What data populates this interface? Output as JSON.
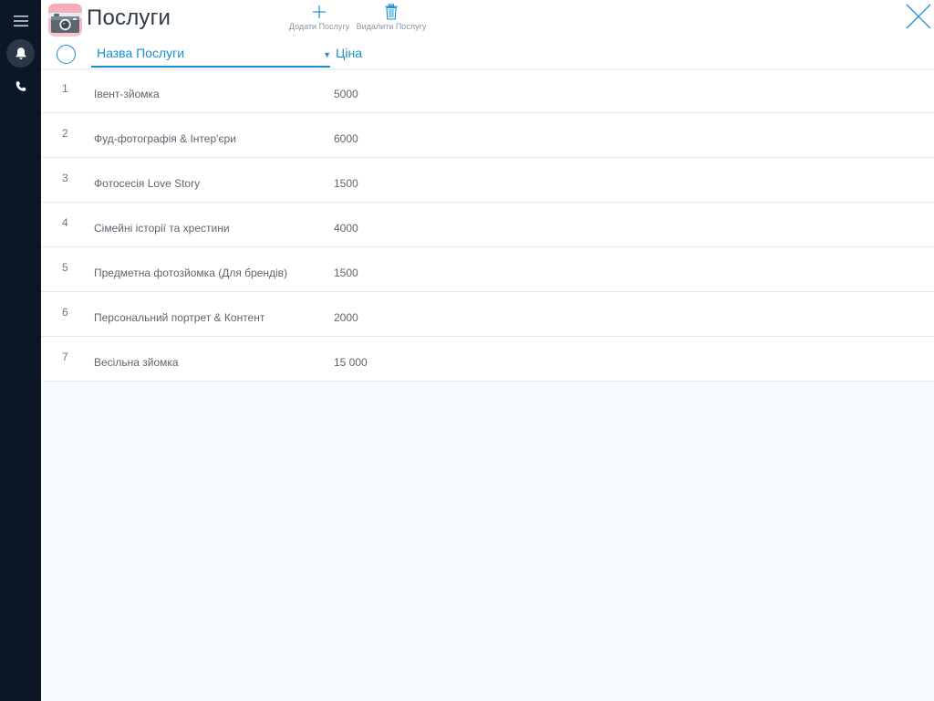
{
  "header": {
    "title": "Послуги",
    "add_label": "Додати Послугу",
    "delete_label": "Видалити Послугу"
  },
  "columns": {
    "name": "Назва Послуги",
    "price": "Ціна"
  },
  "rows": [
    {
      "index": "1",
      "name": "Івент-зйомка",
      "price": "5000"
    },
    {
      "index": "2",
      "name": "Фуд-фотографія & Інтер'єри",
      "price": "6000"
    },
    {
      "index": "3",
      "name": "Фотосесія Love Story",
      "price": "1500"
    },
    {
      "index": "4",
      "name": "Сімейні історії та хрестини",
      "price": "4000"
    },
    {
      "index": "5",
      "name": "Предметна фотозйомка (Для брендів)",
      "price": "1500"
    },
    {
      "index": "6",
      "name": "Персональний портрет & Контент",
      "price": "2000"
    },
    {
      "index": "7",
      "name": "Весільна зйомка",
      "price": "15 000"
    }
  ],
  "icons": {
    "menu": "hamburger-menu-icon",
    "notifications": "bell-icon",
    "calls": "phone-icon",
    "app": "camera-icon",
    "add": "plus-icon",
    "delete": "trash-icon",
    "close": "close-icon"
  },
  "colors": {
    "accent": "#1a8fd0",
    "rail": "#0b1626",
    "rail_active": "#2b3746",
    "app_icon": "#f6a9b6"
  }
}
